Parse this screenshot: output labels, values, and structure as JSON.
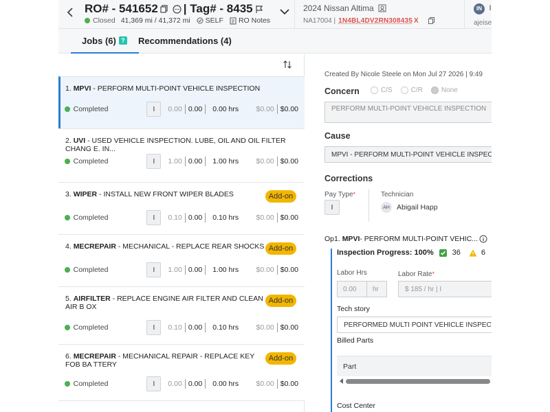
{
  "header": {
    "ro_number": "RO# - 541652",
    "tag": "| Tag# - 8435",
    "status": "Closed",
    "mileage": "41,369 mi / 41,372 mi",
    "payer": "SELF",
    "notes_label": "RO Notes",
    "vehicle": "2024 Nissan Altima",
    "stock": "NA17004 |",
    "vin": "1N4BL4DV2RN308435",
    "vin_suffix": "X",
    "user_initials": "IN",
    "user_name": "Il",
    "user_email": "ajeise"
  },
  "tabs": [
    {
      "label": "Jobs (6)",
      "badge": "?"
    },
    {
      "label": "Recommendations (4)"
    }
  ],
  "jobs": [
    {
      "index": "1.",
      "code": "MPVI",
      "desc": " - PERFORM MULTI-POINT VEHICLE INSPECTION",
      "status": "Completed",
      "pay_type": "I",
      "hrs_a": "0.00",
      "hrs_b": "0.00",
      "hrs": "0.00 hrs",
      "cost": "$0.00",
      "sale": "$0.00",
      "addon": ""
    },
    {
      "index": "2.",
      "code": "UVI",
      "desc": " - USED VEHICLE INSPECTION. LUBE, OIL AND OIL FILTER CHANG E. IN...",
      "status": "Completed",
      "pay_type": "I",
      "hrs_a": "1.00",
      "hrs_b": "0.00",
      "hrs": "1.00 hrs",
      "cost": "$0.00",
      "sale": "$0.00",
      "addon": ""
    },
    {
      "index": "3.",
      "code": "WIPER",
      "desc": " - INSTALL NEW FRONT WIPER BLADES",
      "status": "Completed",
      "pay_type": "I",
      "hrs_a": "0.10",
      "hrs_b": "0.00",
      "hrs": "0.10 hrs",
      "cost": "$0.00",
      "sale": "$0.00",
      "addon": "Add-on"
    },
    {
      "index": "4.",
      "code": "MECREPAIR",
      "desc": " - MECHANICAL - REPLACE REAR SHOCKS",
      "status": "Completed",
      "pay_type": "I",
      "hrs_a": "1.00",
      "hrs_b": "0.00",
      "hrs": "1.00 hrs",
      "cost": "$0.00",
      "sale": "$0.00",
      "addon": "Add-on"
    },
    {
      "index": "5.",
      "code": "AIRFILTER",
      "desc": " - REPLACE ENGINE AIR FILTER AND CLEAN AIR B OX",
      "status": "Completed",
      "pay_type": "I",
      "hrs_a": "0.10",
      "hrs_b": "0.00",
      "hrs": "0.10 hrs",
      "cost": "$0.00",
      "sale": "$0.00",
      "addon": "Add-on"
    },
    {
      "index": "6.",
      "code": "MECREPAIR",
      "desc": " - MECHANICAL REPAIR - REPLACE KEY FOB BA TTERY",
      "status": "Completed",
      "pay_type": "I",
      "hrs_a": "0.00",
      "hrs_b": "0.00",
      "hrs": "0.00 hrs",
      "cost": "$0.00",
      "sale": "$0.00",
      "addon": "Add-on"
    }
  ],
  "detail": {
    "created": "Created By Nicole Steele on Mon Jul 27 2026 | 9:49",
    "concern_label": "Concern",
    "concern_options": [
      "C/S",
      "C/R",
      "None"
    ],
    "concern_text": "PERFORM MULTI-POINT VEHICLE INSPECTION",
    "cause_label": "Cause",
    "cause_text": "MPVI - PERFORM MULTI-POINT VEHICLE INSPECTION",
    "corrections_label": "Corrections",
    "pay_type_label": "Pay Type",
    "pay_type_value": "I",
    "technician_label": "Technician",
    "technician_initials": "AH",
    "technician_name": "Abigail Happ",
    "op_prefix": "Op1.",
    "op_code": "MPVI",
    "op_desc": " - PERFORM MULTI-POINT VEHIC...",
    "inspection_label": "Inspection Progress: 100%",
    "inspection_ok": "36",
    "inspection_warn": "6",
    "labor_hrs_label": "Labor Hrs",
    "labor_hrs_value": "0.00",
    "labor_hrs_unit": "hr",
    "labor_rate_label": "Labor Rate",
    "labor_rate_value": "$ 185 / hr | I",
    "tech_story_label": "Tech story",
    "tech_story_value": "PERFORMED MULTI POINT VEHICLE INSPECTION",
    "billed_parts_label": "Billed Parts",
    "part_col": "Part",
    "cost_center_label": "Cost Center"
  },
  "colors": {
    "accent": "#2b7cd3",
    "status_green": "#4caf50",
    "addon_yellow": "#f2b600",
    "vin_red": "#d9534f"
  }
}
